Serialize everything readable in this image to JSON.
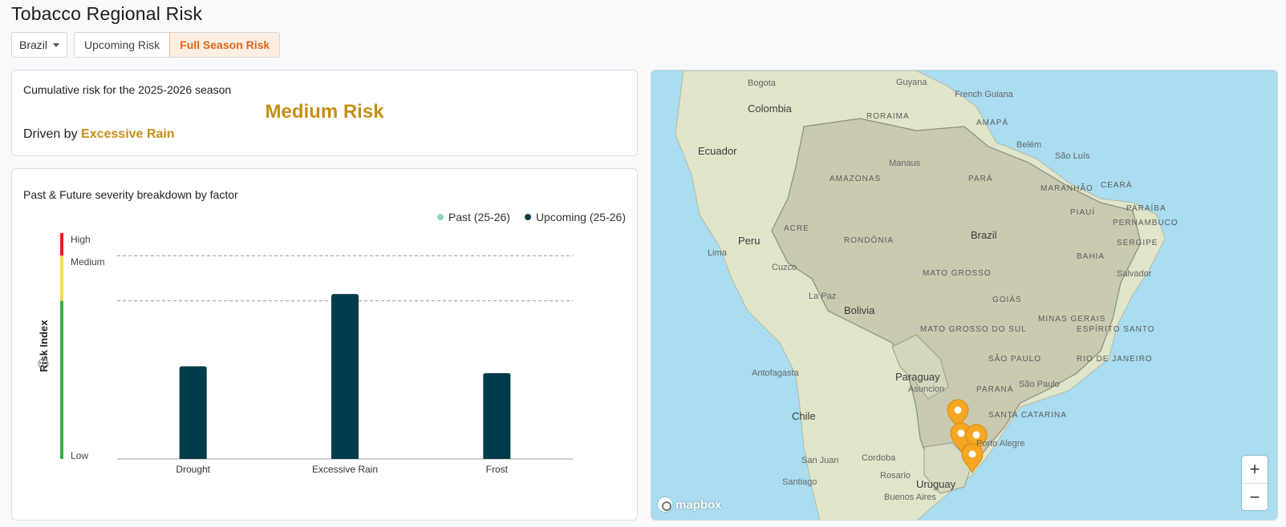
{
  "header": {
    "title": "Tobacco Regional Risk"
  },
  "controls": {
    "region": "Brazil",
    "tabs": [
      {
        "label": "Upcoming Risk",
        "active": false
      },
      {
        "label": "Full Season Risk",
        "active": true
      }
    ]
  },
  "summary": {
    "heading": "Cumulative risk for the 2025-2026 season",
    "risk_level": "Medium Risk",
    "driven_prefix": "Driven by",
    "driver": "Excessive Rain"
  },
  "chart_card": {
    "heading": "Past & Future severity breakdown by factor"
  },
  "chart_data": {
    "type": "bar",
    "categories": [
      "Drought",
      "Excessive Rain",
      "Frost"
    ],
    "series": [
      {
        "name": "Past (25-26)",
        "color": "#8fd6c0",
        "values": [
          0,
          0,
          0
        ]
      },
      {
        "name": "Upcoming (25-26)",
        "color": "#003c4a",
        "values": [
          0.41,
          0.73,
          0.38
        ]
      }
    ],
    "ylabel": "Risk Index",
    "ylim": [
      0,
      1
    ],
    "risk_bands": [
      {
        "label": "Low",
        "from": 0,
        "to": 0.7,
        "color": "#3cb043"
      },
      {
        "label": "Medium",
        "from": 0.7,
        "to": 0.9,
        "color": "#f4e04d"
      },
      {
        "label": "High",
        "from": 0.9,
        "to": 1.0,
        "color": "#e02424"
      }
    ],
    "threshold_lines": [
      0.7,
      0.9
    ],
    "legend_position": "top-right",
    "grid": false
  },
  "map": {
    "countries": [
      "Colombia",
      "Ecuador",
      "Peru",
      "Bolivia",
      "Brazil",
      "Paraguay",
      "Chile",
      "Uruguay",
      "Guyana",
      "French Guiana"
    ],
    "states": [
      "RORAIMA",
      "AMAPÁ",
      "AMAZONAS",
      "PARÁ",
      "MARANHÃO",
      "CEARÁ",
      "PIAUÍ",
      "PARAÍBA",
      "PERNAMBUCO",
      "SERGIPE",
      "BAHIA",
      "ACRE",
      "RONDÔNIA",
      "MATO GROSSO",
      "GOIÁS",
      "MINAS GERAIS",
      "ESPÍRITO SANTO",
      "MATO GROSSO DO SUL",
      "SÃO PAULO",
      "RIO DE JANEIRO",
      "PARANÁ",
      "SANTA CATARINA"
    ],
    "cities": [
      "Bogota",
      "Manaus",
      "Belém",
      "São Luís",
      "Lima",
      "Cuzco",
      "La Paz",
      "Salvador",
      "Antofagasta",
      "Asuncion",
      "São Paulo",
      "Porto Alegre",
      "San Juan",
      "Cordoba",
      "Santiago",
      "Rosario",
      "Buenos Aires"
    ],
    "marker_color": "#f5a623",
    "attribution": "mapbox",
    "zoom_in": "+",
    "zoom_out": "−"
  }
}
